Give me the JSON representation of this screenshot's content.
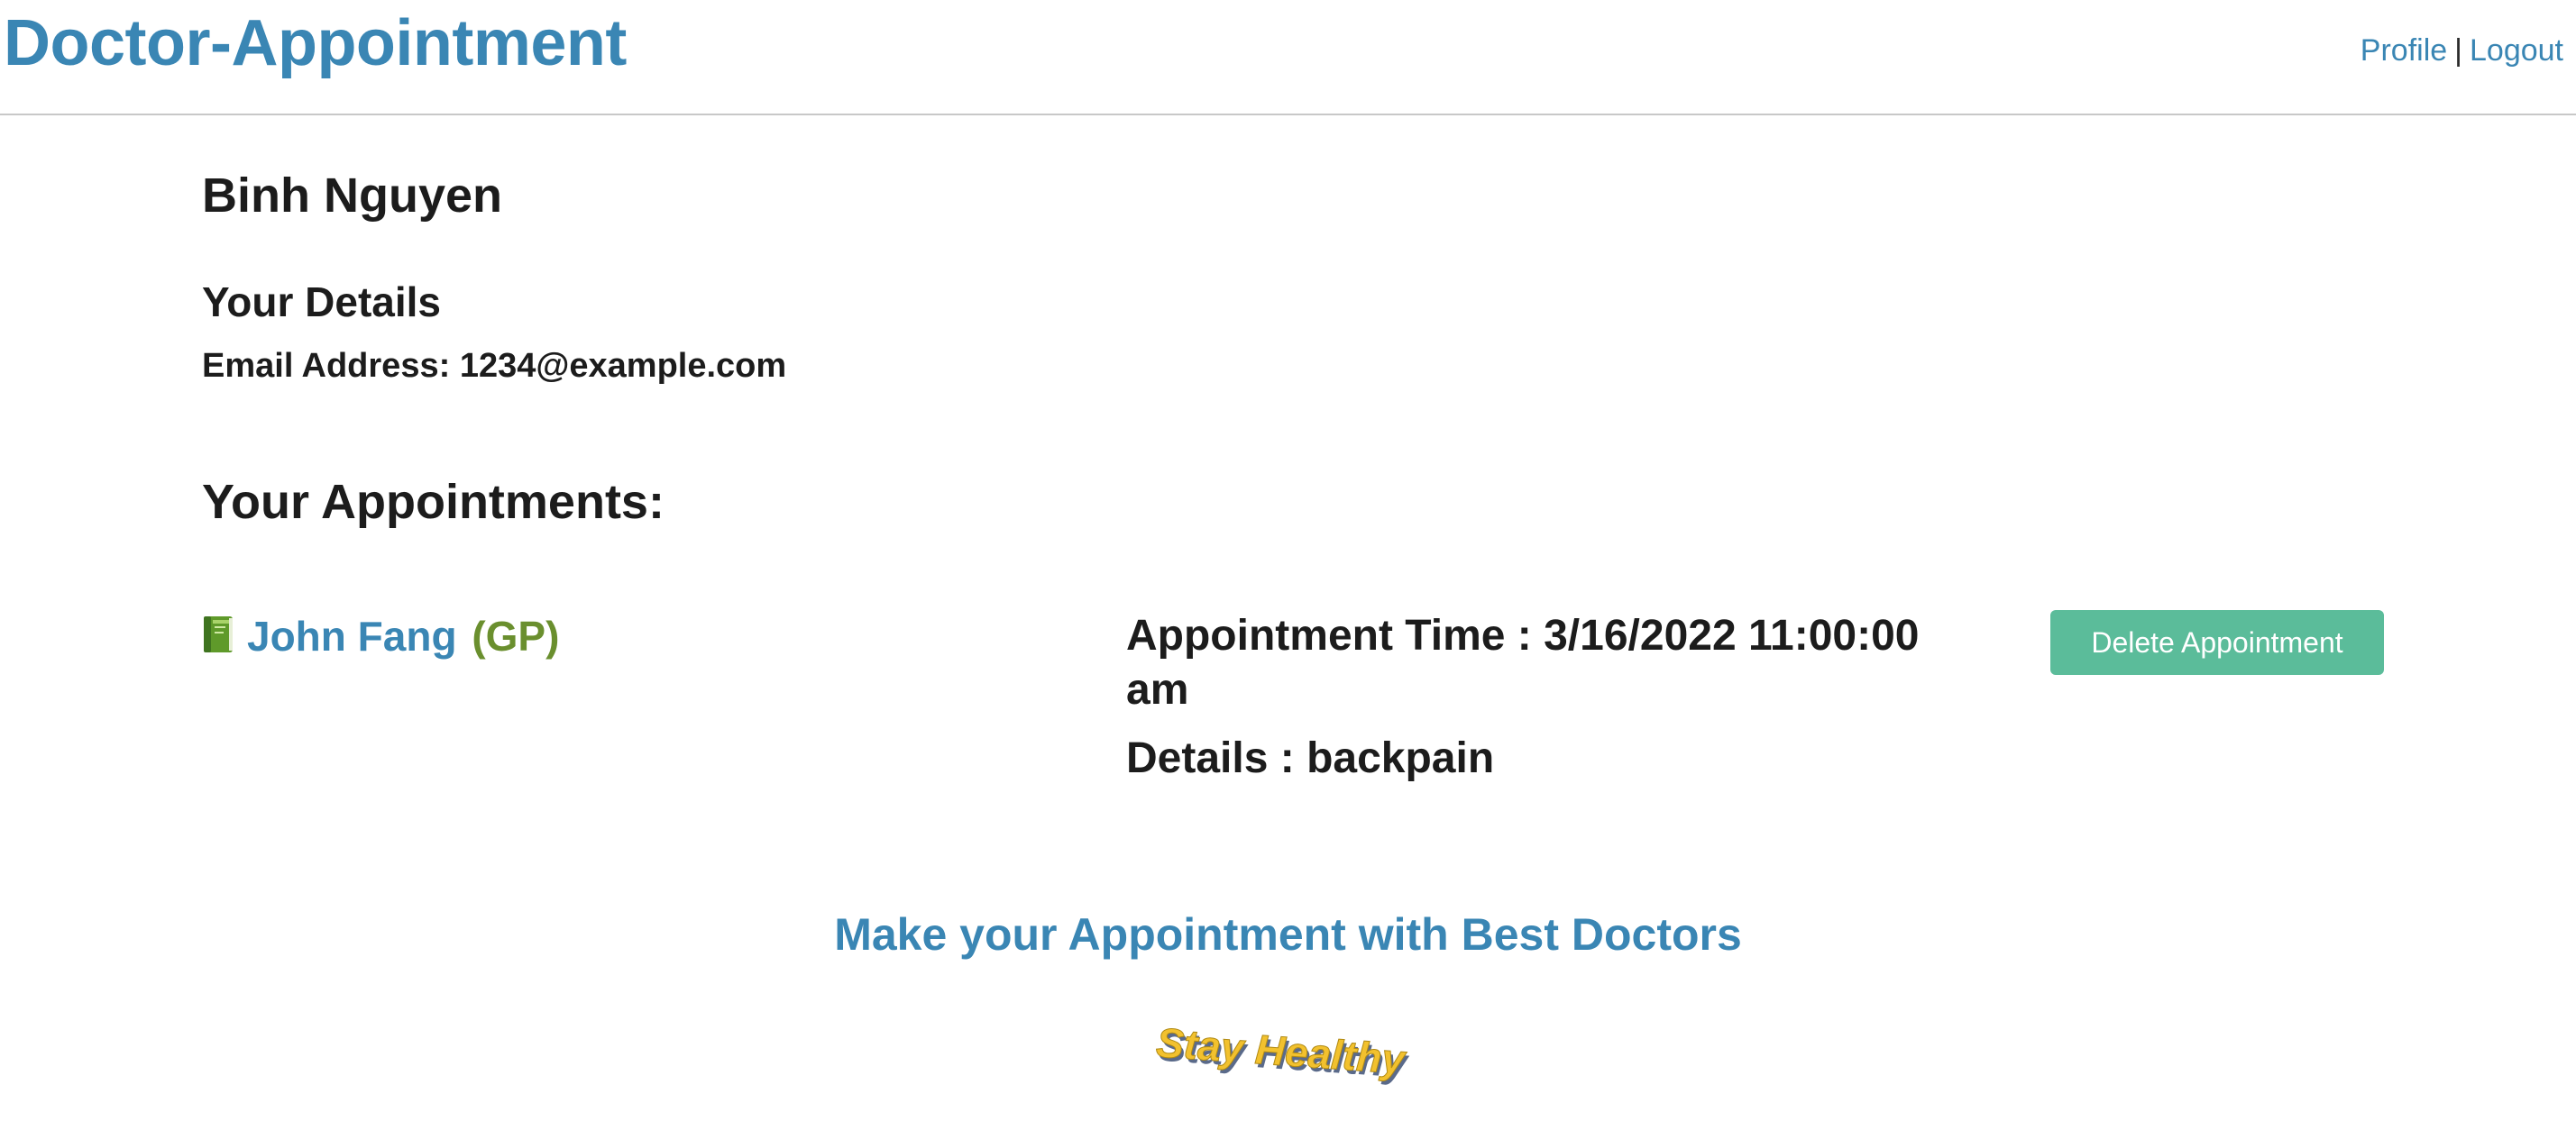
{
  "header": {
    "brand": "Doctor-Appointment",
    "nav": {
      "profile": "Profile",
      "separator": "|",
      "logout": "Logout"
    }
  },
  "user": {
    "name": "Binh Nguyen",
    "details_heading": "Your Details",
    "email_label": "Email Address:",
    "email": "1234@example.com"
  },
  "appointments": {
    "heading": "Your Appointments:",
    "items": [
      {
        "doctor": "John Fang",
        "specialty": "(GP)",
        "time_label": "Appointment Time :",
        "time": "3/16/2022 11:00:00 am",
        "details_label": "Details :",
        "details": "backpain",
        "delete_label": "Delete Appointment",
        "icon": "green-book-icon"
      }
    ]
  },
  "footer": {
    "cta": "Make your Appointment with Best Doctors",
    "logo_text": "Stay Healthy"
  },
  "colors": {
    "brand_blue": "#3a86b4",
    "specialty_green": "#6a8f2e",
    "button_teal": "#5bbc9a",
    "logo_yellow": "#f2c12e"
  }
}
